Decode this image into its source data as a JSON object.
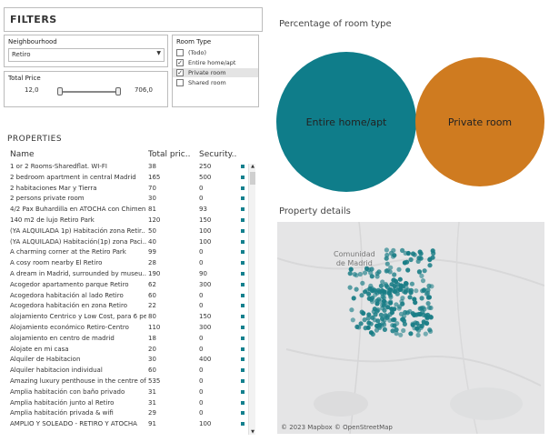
{
  "filters": {
    "title": "FILTERS",
    "neighbourhood": {
      "label": "Neighbourhood",
      "value": "Retiro"
    },
    "total_price": {
      "label": "Total Price",
      "min": "12,0",
      "max": "706,0"
    },
    "room_type": {
      "label": "Room Type",
      "options": [
        {
          "label": "(Todo)",
          "checked": false
        },
        {
          "label": "Entire home/apt",
          "checked": true
        },
        {
          "label": "Private room",
          "checked": true
        },
        {
          "label": "Shared room",
          "checked": false
        }
      ]
    }
  },
  "properties": {
    "title": "PROPERTIES",
    "columns": [
      "Name",
      "Total pric..",
      "Security.."
    ],
    "rows": [
      [
        "1 or 2 Rooms-Sharedflat. WI-FI",
        "38",
        "250"
      ],
      [
        "2 bedroom apartment in central Madrid",
        "165",
        "500"
      ],
      [
        "2 habitaciones Mar y Tierra",
        "70",
        "0"
      ],
      [
        "2 persons private room",
        "30",
        "0"
      ],
      [
        "4/2 Pax Buhardilla en ATOCHA con Chimen..",
        "81",
        "93"
      ],
      [
        "140 m2 de lujo Retiro Park",
        "120",
        "150"
      ],
      [
        "(YA ALQUILADA 1p) Habitación zona Retir..",
        "50",
        "100"
      ],
      [
        "(YA ALQUILADA) Habitación(1p) zona Paci..",
        "40",
        "100"
      ],
      [
        "A charming corner at the Retiro Park",
        "99",
        "0"
      ],
      [
        "A cosy room nearby El Retiro",
        "28",
        "0"
      ],
      [
        "A dream in Madrid, surrounded by museu..",
        "190",
        "90"
      ],
      [
        "Acogedor apartamento parque Retiro",
        "62",
        "300"
      ],
      [
        "Acogedora habitación al lado Retiro",
        "60",
        "0"
      ],
      [
        "Acogedora habitación en zona Retiro",
        "22",
        "0"
      ],
      [
        "alojamiento Centrico y Low Cost, para 6 pe..",
        "80",
        "150"
      ],
      [
        "Alojamiento económico Retiro-Centro",
        "110",
        "300"
      ],
      [
        "alojamiento en centro de madrid",
        "18",
        "0"
      ],
      [
        "Alojate en mi casa",
        "20",
        "0"
      ],
      [
        "Alquiler de Habitacion",
        "30",
        "400"
      ],
      [
        "Alquiler habitacion individual",
        "60",
        "0"
      ],
      [
        "Amazing luxury penthouse in the centre of..",
        "535",
        "0"
      ],
      [
        "Amplia habitación con baño privado",
        "31",
        "0"
      ],
      [
        "Amplia habitación junto al Retiro",
        "31",
        "0"
      ],
      [
        "Amplia habitación privada & wifi",
        "29",
        "0"
      ],
      [
        "AMPLIO Y SOLEADO - RETIRO Y ATOCHA",
        "91",
        "100"
      ]
    ]
  },
  "room_type_chart": {
    "title": "Percentage of room type",
    "bubbles": [
      {
        "label": "Entire home/apt",
        "color": "#0f7d8a"
      },
      {
        "label": "Private room",
        "color": "#cf7b20"
      }
    ]
  },
  "map": {
    "title": "Property details",
    "place_label_1": "Comunidad",
    "place_label_2": "de Madrid",
    "attribution": "© 2023 Mapbox © OpenStreetMap",
    "dot_color": "#1a7d86"
  }
}
